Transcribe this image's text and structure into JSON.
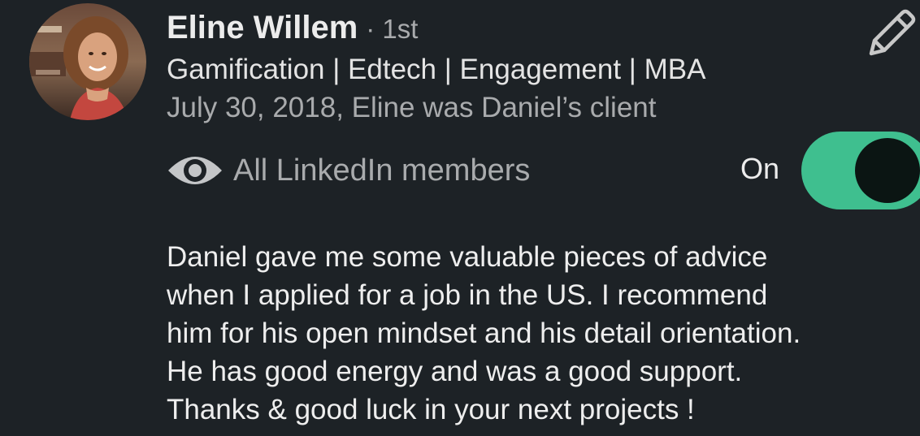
{
  "recommender": {
    "name": "Eline Willem",
    "degree": "· 1st",
    "headline": "Gamification | Edtech | Engagement | MBA",
    "date_relation": "July 30, 2018, Eline was Daniel’s client"
  },
  "icons": {
    "edit": "pencil-icon",
    "visibility": "eye-icon"
  },
  "visibility": {
    "label": "All LinkedIn members",
    "toggle_label": "On",
    "toggle_on": true
  },
  "recommendation": {
    "lines": [
      "Daniel gave me some valuable pieces of advice",
      "when I applied for a job in the US. I recommend",
      "him for his open mindset and his detail orientation.",
      "He has good energy and was a good support.",
      "Thanks & good luck in your next projects !"
    ]
  },
  "colors": {
    "background": "#1d2226",
    "toggle_track": "#3fbf8f",
    "secondary_text": "#a9abad"
  }
}
